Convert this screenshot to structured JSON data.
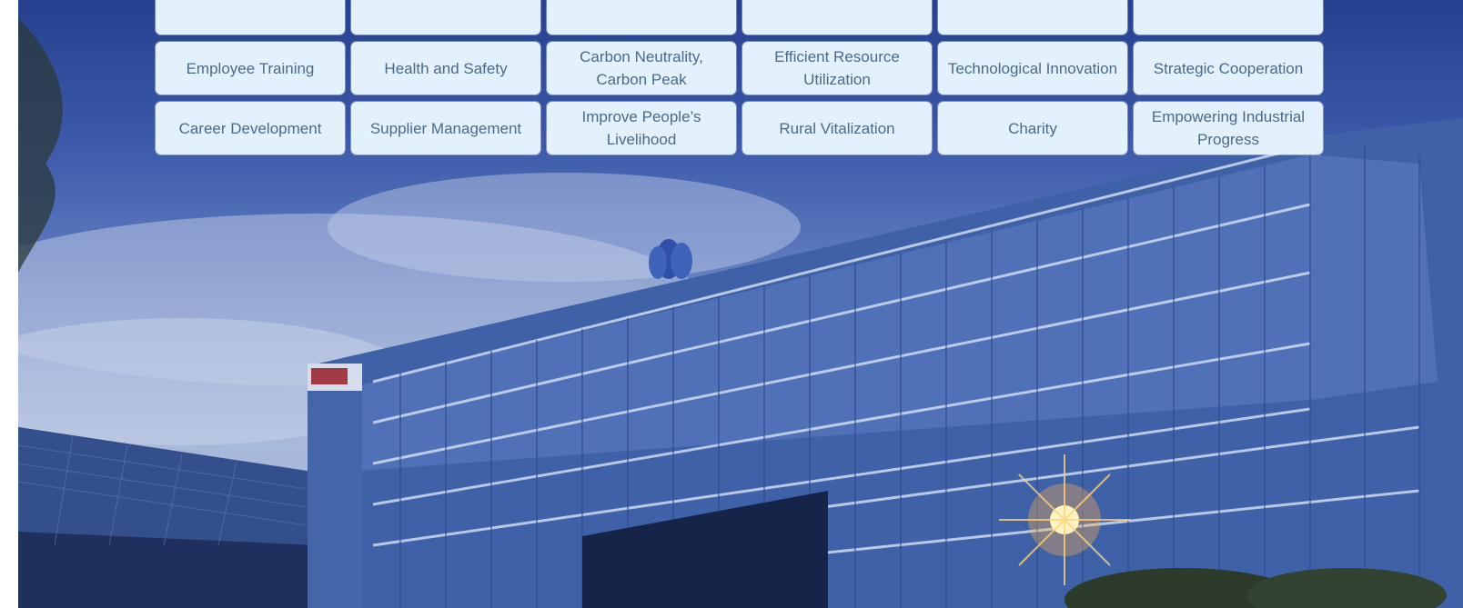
{
  "topics": {
    "row_partial": [
      "",
      "",
      "",
      "",
      "",
      ""
    ],
    "row1": [
      {
        "label": "Employee Training"
      },
      {
        "label": "Health and Safety"
      },
      {
        "label": "Carbon Neutrality, Carbon Peak"
      },
      {
        "label": "Efficient Resource Utilization"
      },
      {
        "label": "Technological Innovation"
      },
      {
        "label": "Strategic Cooperation"
      }
    ],
    "row2": [
      {
        "label": "Career Development"
      },
      {
        "label": "Supplier Management"
      },
      {
        "label": "Improve People’s Livelihood"
      },
      {
        "label": "Rural Vitalization"
      },
      {
        "label": "Charity"
      },
      {
        "label": "Empowering Industrial Progress"
      }
    ]
  },
  "photo": {
    "subject": "office-building-exterior",
    "colors": {
      "sky_top": "#27408f",
      "sky_bottom": "#a9b9da",
      "glass": "#4d6fb3",
      "tile": "#e2f1fb",
      "tile_text": "#4b6a88"
    }
  }
}
